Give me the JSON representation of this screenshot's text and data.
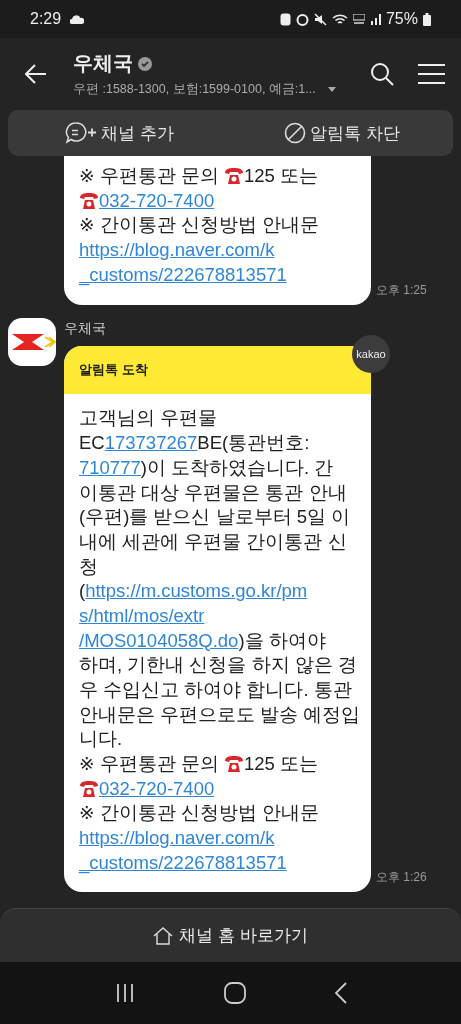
{
  "status_bar": {
    "time": "2:29",
    "battery": "75%"
  },
  "header": {
    "title": "우체국",
    "subtitle": "우편 :1588-1300, 보험:1599-0100, 예금:1..."
  },
  "actions": [
    {
      "kind": "add",
      "label": "채널 추가"
    },
    {
      "kind": "block",
      "label": "알림톡 차단"
    }
  ],
  "messages": [
    {
      "time": "오후 1:25",
      "lines": [
        [
          {
            "kind": "text",
            "text": "※ 우편통관 문의 "
          },
          {
            "kind": "phone"
          },
          {
            "kind": "text",
            "text": "125 또는"
          }
        ],
        [
          {
            "kind": "phone"
          },
          {
            "kind": "link",
            "text": "032-720-7400"
          }
        ],
        [
          {
            "kind": "text",
            "text": "※ 간이통관 신청방법 안내문"
          }
        ],
        [
          {
            "kind": "link",
            "text": "https://blog.naver.com/k"
          }
        ],
        [
          {
            "kind": "link",
            "text": "_customs/222678813571"
          }
        ]
      ]
    },
    {
      "sender": "우체국",
      "badge": "kakao",
      "title": "알림톡 도착",
      "time": "오후 1:26",
      "lines": [
        [
          {
            "kind": "text",
            "text": "고객님의 우편물"
          }
        ],
        [
          {
            "kind": "text",
            "text": "EC"
          },
          {
            "kind": "link",
            "text": "173737267"
          },
          {
            "kind": "text",
            "text": "BE(통관번호:"
          }
        ],
        [
          {
            "kind": "link",
            "text": "710777"
          },
          {
            "kind": "text",
            "text": ")이 도착하였습니다. 간"
          }
        ],
        [
          {
            "kind": "text",
            "text": "이통관 대상 우편물은 통관 안내"
          }
        ],
        [
          {
            "kind": "text",
            "text": "(우편)를 받으신 날로부터 5일 이"
          }
        ],
        [
          {
            "kind": "text",
            "text": "내에 세관에 우편물 간이통관 신"
          }
        ],
        [
          {
            "kind": "text",
            "text": "청"
          }
        ],
        [
          {
            "kind": "text",
            "text": "("
          },
          {
            "kind": "link",
            "text": "https://m.customs.go.kr/pm"
          }
        ],
        [
          {
            "kind": "link",
            "text": "s/html/mos/extr"
          }
        ],
        [
          {
            "kind": "link",
            "text": "/MOS0104058Q.do"
          },
          {
            "kind": "text",
            "text": ")을 하여야"
          }
        ],
        [
          {
            "kind": "text",
            "text": "하며, 기한내 신청을 하지 않은 경"
          }
        ],
        [
          {
            "kind": "text",
            "text": "우 수입신고 하여야 합니다. 통관"
          }
        ],
        [
          {
            "kind": "text",
            "text": "안내문은 우편으로도 발송 예정입"
          }
        ],
        [
          {
            "kind": "text",
            "text": "니다."
          }
        ],
        [
          {
            "kind": "text",
            "text": "※ 우편통관 문의 "
          },
          {
            "kind": "phone"
          },
          {
            "kind": "text",
            "text": "125 또는"
          }
        ],
        [
          {
            "kind": "phone"
          },
          {
            "kind": "link",
            "text": "032-720-7400"
          }
        ],
        [
          {
            "kind": "text",
            "text": "※ 간이통관 신청방법 안내문"
          }
        ],
        [
          {
            "kind": "link",
            "text": "https://blog.naver.com/k"
          }
        ],
        [
          {
            "kind": "link",
            "text": "_customs/222678813571"
          }
        ]
      ]
    }
  ],
  "home_button": "채널 홈 바로가기"
}
